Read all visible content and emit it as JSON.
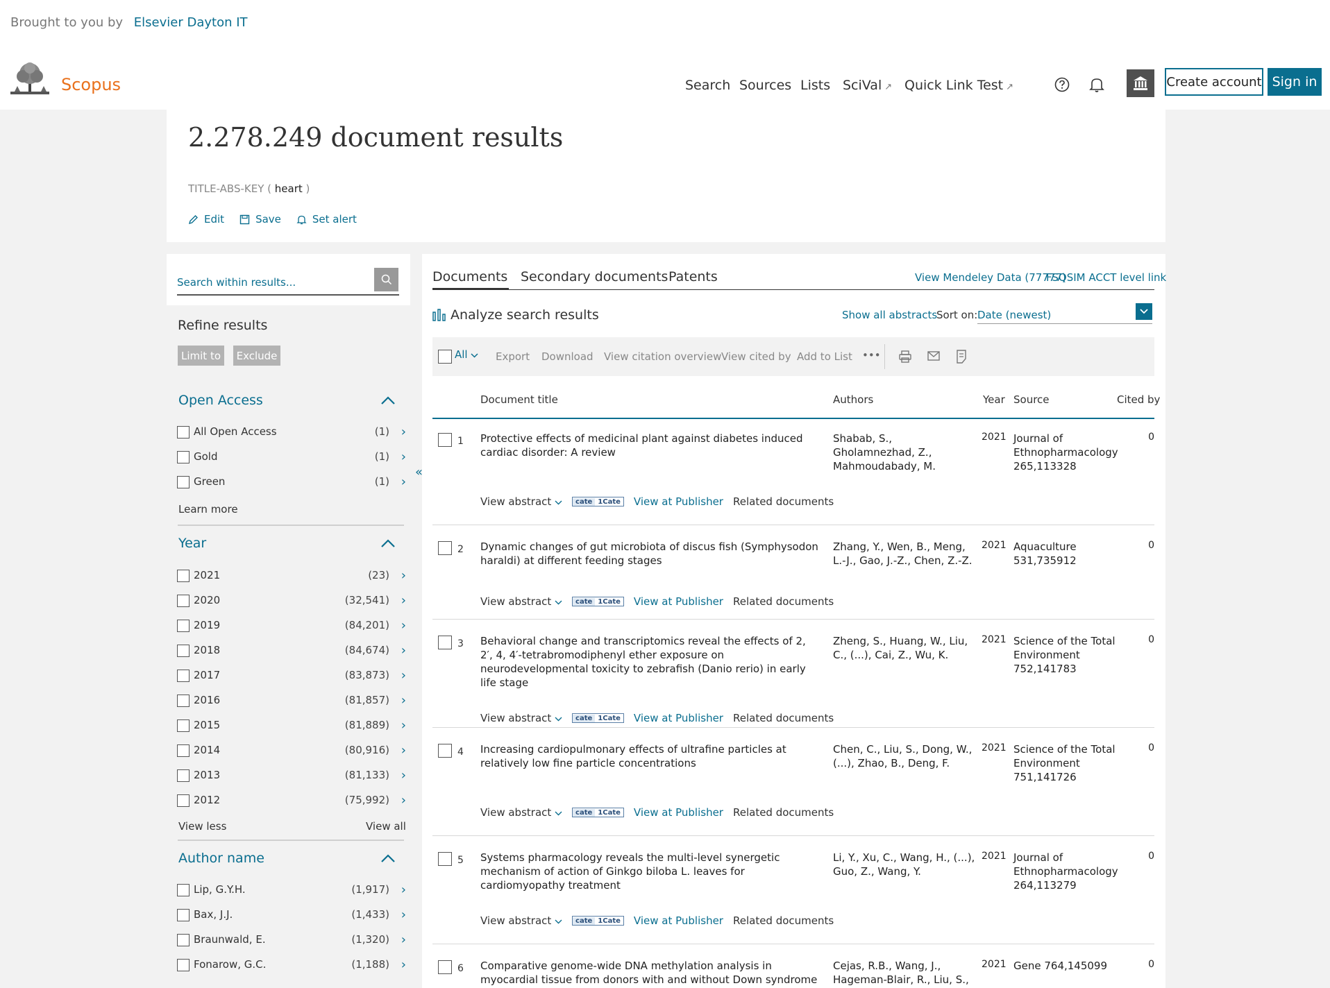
{
  "header": {
    "brought_prefix": "Brought to you by",
    "brought_org": "Elsevier Dayton IT",
    "brand": "Scopus",
    "nav": [
      {
        "label": "Search",
        "external": false
      },
      {
        "label": "Sources",
        "external": false
      },
      {
        "label": "Lists",
        "external": false
      },
      {
        "label": "SciVal",
        "external": true
      },
      {
        "label": "Quick Link Test",
        "external": true
      }
    ],
    "ext_icon": "↗",
    "create_account": "Create account",
    "sign_in": "Sign in"
  },
  "results": {
    "title": "2.278.249 document results",
    "query_field": "TITLE-ABS-KEY (",
    "query_term": "heart",
    "query_close": ")",
    "edit": "Edit",
    "save": "Save",
    "set_alert": "Set alert"
  },
  "sidebar": {
    "search_placeholder": "Search within results...",
    "refine": "Refine results",
    "limit_to": "Limit to",
    "exclude": "Exclude",
    "open_access": {
      "title": "Open Access",
      "items": [
        {
          "label": "All Open Access",
          "count": "(1)"
        },
        {
          "label": "Gold",
          "count": "(1)"
        },
        {
          "label": "Green",
          "count": "(1)"
        }
      ],
      "learn_more": "Learn more"
    },
    "year": {
      "title": "Year",
      "items": [
        {
          "label": "2021",
          "count": "(23)"
        },
        {
          "label": "2020",
          "count": "(32,541)"
        },
        {
          "label": "2019",
          "count": "(84,201)"
        },
        {
          "label": "2018",
          "count": "(84,674)"
        },
        {
          "label": "2017",
          "count": "(83,873)"
        },
        {
          "label": "2016",
          "count": "(81,857)"
        },
        {
          "label": "2015",
          "count": "(81,889)"
        },
        {
          "label": "2014",
          "count": "(80,916)"
        },
        {
          "label": "2013",
          "count": "(81,133)"
        },
        {
          "label": "2012",
          "count": "(75,992)"
        }
      ],
      "view_less": "View less",
      "view_all": "View all"
    },
    "author": {
      "title": "Author name",
      "items": [
        {
          "label": "Lip, G.Y.H.",
          "count": "(1,917)"
        },
        {
          "label": "Bax, J.J.",
          "count": "(1,433)"
        },
        {
          "label": "Braunwald, E.",
          "count": "(1,320)"
        },
        {
          "label": "Fonarow, G.C.",
          "count": "(1,188)"
        }
      ]
    }
  },
  "main": {
    "tabs": [
      "Documents",
      "Secondary documents",
      "Patents"
    ],
    "mendeley": "View Mendeley Data (77777)",
    "fsqsim": "FSQSIM ACCT level link",
    "analyze": "Analyze search results",
    "show_abstracts": "Show all abstracts",
    "sort_label": "Sort on:",
    "sort_value": "Date (newest)",
    "toolbar": {
      "all": "All",
      "export": "Export",
      "download": "Download",
      "citation": "View citation overview",
      "cited_by": "View cited by",
      "add_list": "Add to List",
      "more": "•••"
    },
    "columns": {
      "title": "Document title",
      "authors": "Authors",
      "year": "Year",
      "source": "Source",
      "cited": "Cited by"
    },
    "row_links": {
      "view_abstract": "View abstract",
      "cate_a": "cate",
      "cate_b": "1Cate",
      "publisher": "View at Publisher",
      "related": "Related documents"
    },
    "rows": [
      {
        "num": "1",
        "title": "Protective effects of medicinal plant against diabetes induced cardiac disorder: A review",
        "authors": "Shabab, S., Gholamnezhad, Z., Mahmoudabady, M.",
        "year": "2021",
        "source": "Journal of Ethnopharmacology 265,113328",
        "cited": "0"
      },
      {
        "num": "2",
        "title": "Dynamic changes of gut microbiota of discus fish (Symphysodon haraldi) at different feeding stages",
        "authors": "Zhang, Y., Wen, B., Meng, L.-J., Gao, J.-Z., Chen, Z.-Z.",
        "year": "2021",
        "source": "Aquaculture 531,735912",
        "cited": "0"
      },
      {
        "num": "3",
        "title": "Behavioral change and transcriptomics reveal the effects of 2, 2′, 4, 4′-tetrabromodiphenyl ether exposure on neurodevelopmental toxicity to zebrafish (Danio rerio) in early life stage",
        "authors": "Zheng, S., Huang, W., Liu, C., (...), Cai, Z., Wu, K.",
        "year": "2021",
        "source": "Science of the Total Environment 752,141783",
        "cited": "0"
      },
      {
        "num": "4",
        "title": "Increasing cardiopulmonary effects of ultrafine particles at relatively low fine particle concentrations",
        "authors": "Chen, C., Liu, S., Dong, W., (...), Zhao, B., Deng, F.",
        "year": "2021",
        "source": "Science of the Total Environment 751,141726",
        "cited": "0"
      },
      {
        "num": "5",
        "title": "Systems pharmacology reveals the multi-level synergetic mechanism of action of Ginkgo biloba L. leaves for cardiomyopathy treatment",
        "authors": "Li, Y., Xu, C., Wang, H., (...), Guo, Z., Wang, Y.",
        "year": "2021",
        "source": "Journal of Ethnopharmacology 264,113279",
        "cited": "0"
      },
      {
        "num": "6",
        "title": "Comparative genome-wide DNA methylation analysis in myocardial tissue from donors with and without Down syndrome",
        "authors": "Cejas, R.B., Wang, J., Hageman-Blair, R., Liu, S.,",
        "year": "2021",
        "source": "Gene 764,145099",
        "cited": "0"
      }
    ]
  }
}
